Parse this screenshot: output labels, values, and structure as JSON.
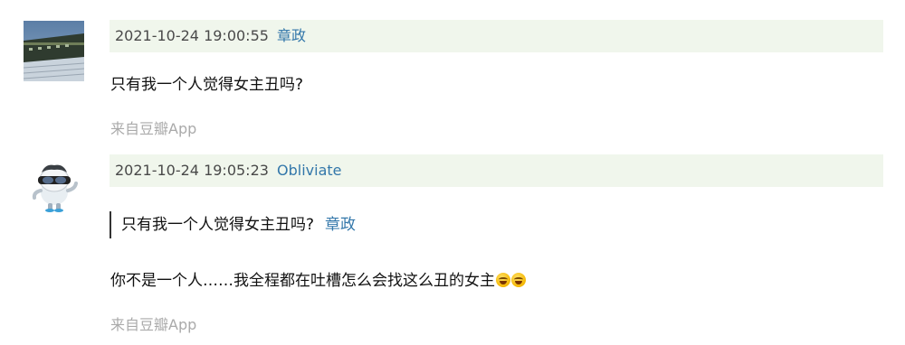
{
  "comments": [
    {
      "avatar": "train-photo-avatar",
      "timestamp": "2021-10-24 19:00:55",
      "username": "章政",
      "text": "只有我一个人觉得女主丑吗?",
      "source": "来自豆瓣App"
    },
    {
      "avatar": "cartoon-figure-avatar",
      "timestamp": "2021-10-24 19:05:23",
      "username": "Obliviate",
      "quote": {
        "text": "只有我一个人觉得女主丑吗?",
        "username": "章政"
      },
      "text": "你不是一个人……我全程都在吐槽怎么会找这么丑的女主",
      "emoji": [
        "rolling-on-floor-laughing-emoji",
        "rolling-on-floor-laughing-emoji"
      ],
      "source": "来自豆瓣App"
    }
  ],
  "colors": {
    "meta_bar_bg": "#f0f6ec",
    "link": "#3377aa",
    "source_text": "#aaaaaa"
  }
}
